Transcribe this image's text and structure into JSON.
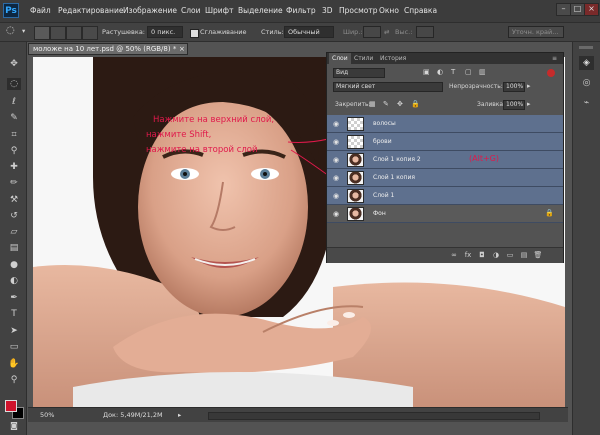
{
  "app": {
    "logo": "Ps"
  },
  "menu": [
    "Файл",
    "Редактирование",
    "Изображение",
    "Слои",
    "Шрифт",
    "Выделение",
    "Фильтр",
    "3D",
    "Просмотр",
    "Окно",
    "Справка"
  ],
  "window_controls": [
    "–",
    "□",
    "×"
  ],
  "options_bar": {
    "feather_label": "Растушевка:",
    "feather_value": "0 пикс.",
    "antialias_label": "Сглаживание",
    "style_label": "Стиль:",
    "style_value": "Обычный",
    "width_label": "Шир.:",
    "height_label": "Выс.:",
    "refine_button": "Уточн. край..."
  },
  "document": {
    "tab_title": "моложе на 10 лет.psd @ 50% (RGB/8) *",
    "zoom": "50%",
    "doc_info": "Док: 5,49M/21,2M"
  },
  "layers_panel": {
    "tabs": [
      "Слои",
      "Стили",
      "История"
    ],
    "kind_filter": "Вид",
    "blend_mode": "Мягкий свет",
    "opacity_label": "Непрозрачность:",
    "opacity_value": "100%",
    "lock_label": "Закрепить:",
    "fill_label": "Заливка:",
    "fill_value": "100%",
    "group_label": "(Alt+G)",
    "layers": [
      {
        "name": "волосы",
        "thumb": "transparent",
        "selected": true
      },
      {
        "name": "брови",
        "thumb": "transparent",
        "selected": true
      },
      {
        "name": "Слой 1 копия 2",
        "thumb": "face",
        "selected": true
      },
      {
        "name": "Слой 1 копия",
        "thumb": "face",
        "selected": true
      },
      {
        "name": "Слой 1",
        "thumb": "face",
        "selected": true
      },
      {
        "name": "Фон",
        "thumb": "face",
        "selected": false,
        "locked": true
      }
    ]
  },
  "annotation": {
    "line1": "Нажмите на верхний слой,",
    "line2": "нажмите Shift,",
    "line3": "нажмите на второй слой",
    "color": "#e0194b"
  },
  "colors": {
    "layer_selected": "#5e708e",
    "foreground": "#d0132c",
    "background": "#000000"
  }
}
